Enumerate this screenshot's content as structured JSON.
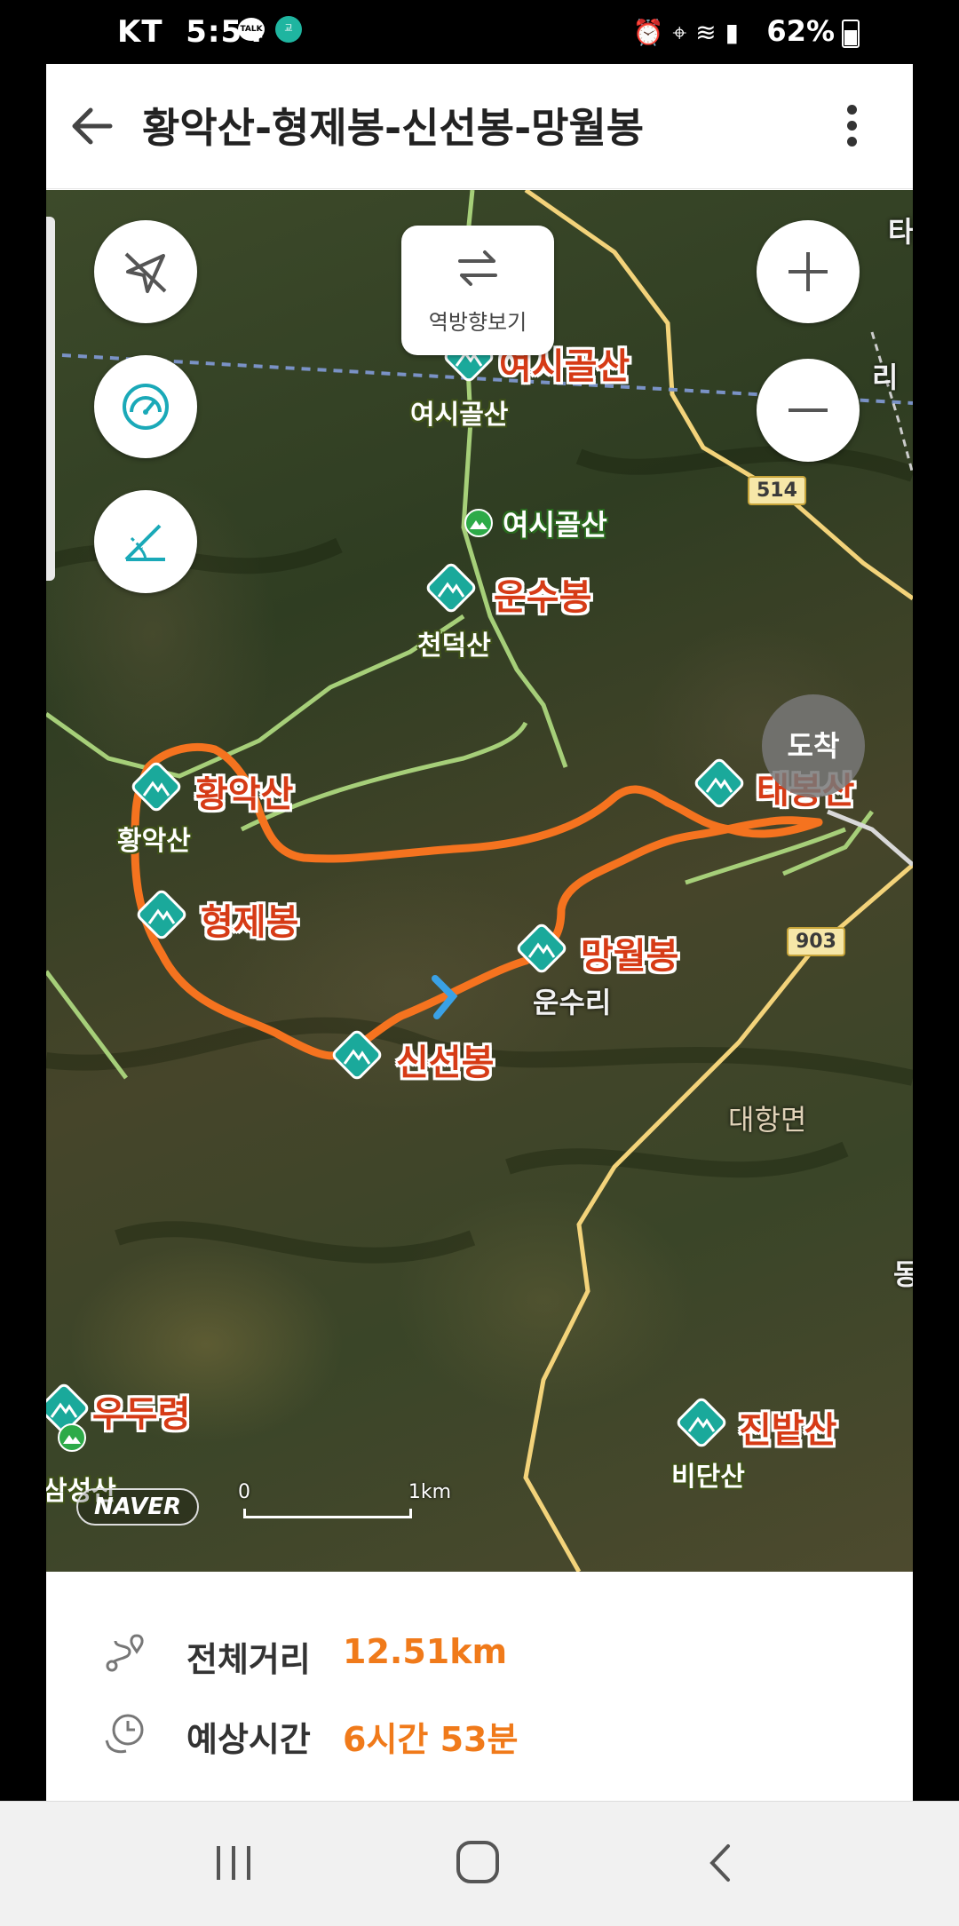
{
  "status": {
    "carrier": "KT",
    "time": "5:54",
    "talk": "TALK",
    "badge": "교",
    "battery": "62%"
  },
  "header": {
    "title": "황악산-형제봉-신선봉-망월봉"
  },
  "map": {
    "reverse_label": "역방향보기",
    "arrive_label": "도착",
    "naver": "NAVER",
    "scale_start": "0",
    "scale_end": "1km",
    "route_color": "#f5731f",
    "marker_color": "#1aa99b",
    "pois": [
      {
        "name": "여시골산",
        "sub": "여시골산"
      },
      {
        "name": "운수봉",
        "sub": "천덕산"
      },
      {
        "name": "황악산",
        "sub": "황악산"
      },
      {
        "name": "형제봉",
        "sub": ""
      },
      {
        "name": "신선봉",
        "sub": ""
      },
      {
        "name": "망월봉",
        "sub": "운수리"
      },
      {
        "name": "태봉산",
        "sub": ""
      },
      {
        "name": "우두령",
        "sub": "삼성산"
      },
      {
        "name": "진밭산",
        "sub": "비단산"
      }
    ],
    "trail_labels": [
      "여시골산"
    ],
    "district": "대항면",
    "road_numbers": [
      "514",
      "903"
    ],
    "edge_labels": [
      "타",
      "리",
      "동"
    ]
  },
  "summary": {
    "distance_label": "전체거리",
    "distance_value": "12.51km",
    "time_label": "예상시간",
    "time_value": "6시간 53분"
  }
}
